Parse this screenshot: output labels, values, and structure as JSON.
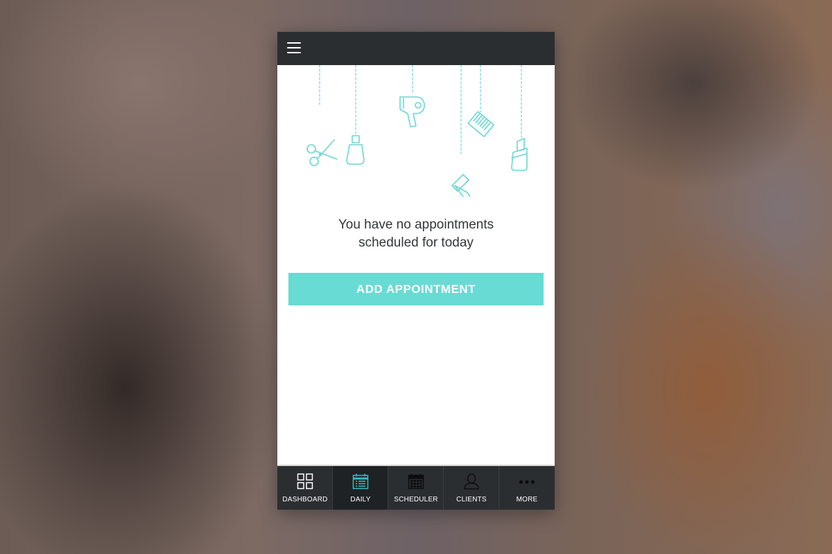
{
  "header": {
    "menu_icon": "hamburger-menu-icon"
  },
  "illustration": {
    "accent_color": "#6cd6d4",
    "items": [
      "scissors-icon",
      "nail-polish-icon",
      "hair-dryer-icon",
      "comb-icon",
      "straight-razor-icon",
      "lipstick-icon"
    ]
  },
  "empty_state": {
    "line1": "You have no appointments",
    "line2": "scheduled for today"
  },
  "actions": {
    "add_appointment": "ADD APPOINTMENT",
    "color": "#68dbd4"
  },
  "tabs": [
    {
      "label": "DASHBOARD",
      "icon": "dashboard-grid-icon",
      "active": false
    },
    {
      "label": "DAILY",
      "icon": "daily-calendar-icon",
      "active": true
    },
    {
      "label": "SCHEDULER",
      "icon": "scheduler-calendar-icon",
      "active": false
    },
    {
      "label": "CLIENTS",
      "icon": "client-person-icon",
      "active": false
    },
    {
      "label": "MORE",
      "icon": "more-dots-icon",
      "active": false
    }
  ],
  "colors": {
    "bar_background": "#2b2e31",
    "active_tab_background": "#1f2225",
    "active_tab_icon": "#3bb8c8"
  }
}
